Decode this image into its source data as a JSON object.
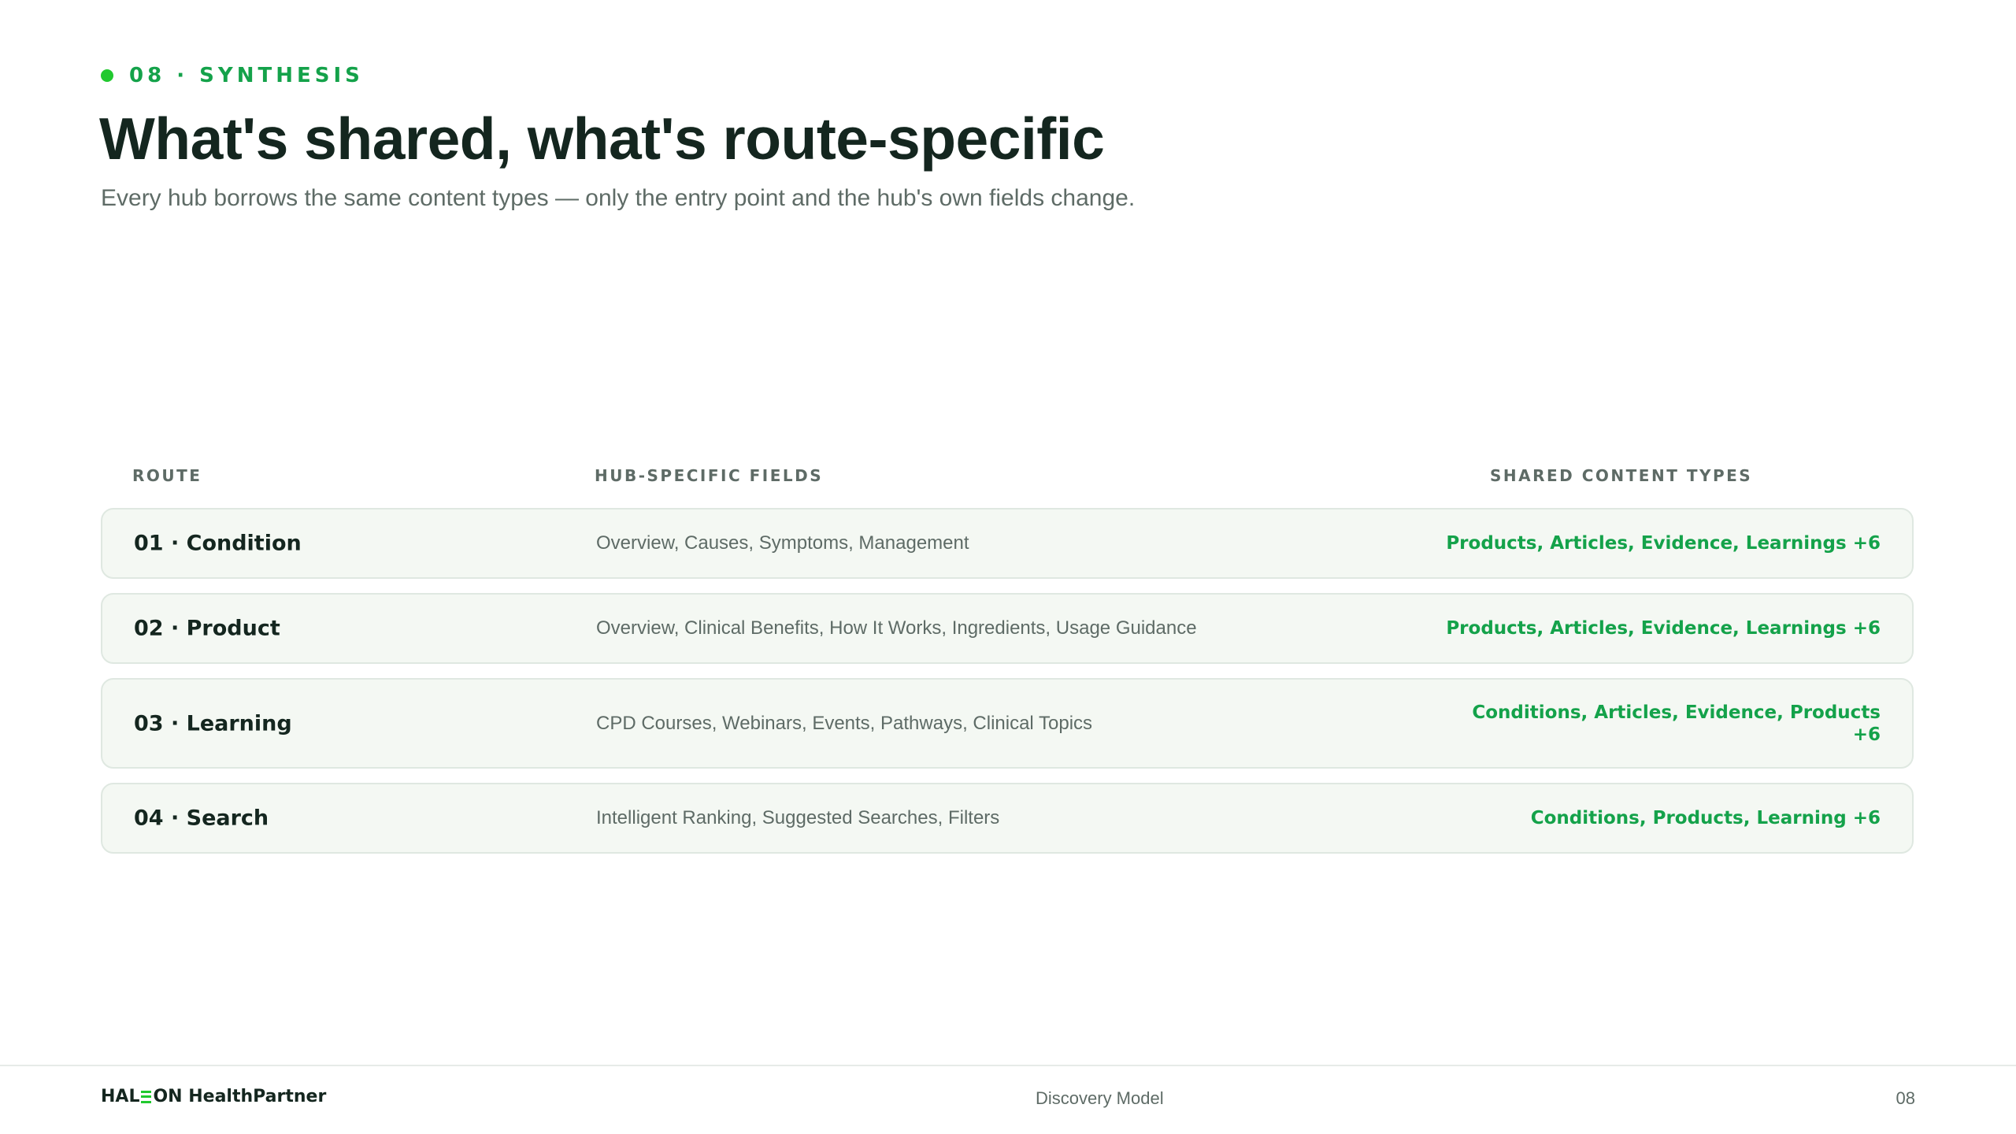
{
  "slide": {
    "eyebrow": "08 · SYNTHESIS",
    "title": "What's shared, what's route-specific",
    "subtitle": "Every hub borrows the same content types — only the entry point and the hub's own fields change."
  },
  "table": {
    "headers": {
      "route": "ROUTE",
      "fields": "HUB-SPECIFIC FIELDS",
      "shared": "SHARED CONTENT TYPES"
    },
    "rows": [
      {
        "route": "01 · Condition",
        "fields": "Overview, Causes, Symptoms, Management",
        "shared": "Products, Articles, Evidence, Learnings +6"
      },
      {
        "route": "02 · Product",
        "fields": "Overview, Clinical Benefits, How It Works, Ingredients, Usage Guidance",
        "shared": "Products, Articles, Evidence, Learnings +6"
      },
      {
        "route": "03 · Learning",
        "fields": "CPD Courses, Webinars, Events, Pathways, Clinical Topics",
        "shared": "Conditions, Articles, Evidence, Products +6"
      },
      {
        "route": "04 · Search",
        "fields": "Intelligent Ranking, Suggested Searches, Filters",
        "shared": "Conditions, Products, Learning +6"
      }
    ]
  },
  "footer": {
    "brand_prefix": "HAL",
    "brand_suffix": "ON HealthPartner",
    "center": "Discovery Model",
    "page": "08"
  },
  "colors": {
    "accent_green": "#14a24a",
    "dot_green": "#21c92f",
    "heading": "#14261f",
    "muted": "#5e6b66",
    "row_background": "#f4f8f3",
    "row_border": "#dfe8e1"
  }
}
